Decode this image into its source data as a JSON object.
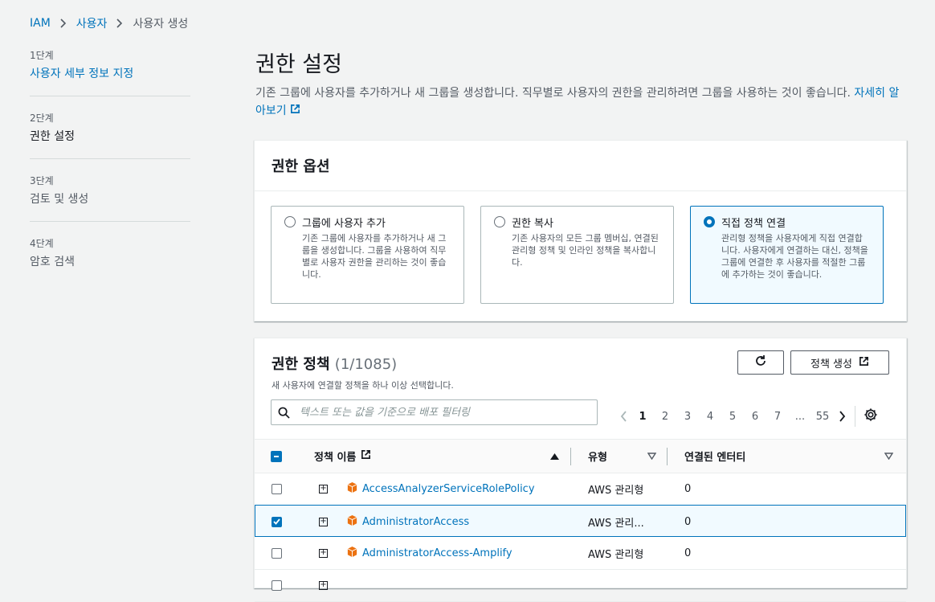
{
  "breadcrumb": [
    "IAM",
    "사용자",
    "사용자 생성"
  ],
  "steps": [
    {
      "num": "1단계",
      "label": "사용자 세부 정보 지정"
    },
    {
      "num": "2단계",
      "label": "권한 설정"
    },
    {
      "num": "3단계",
      "label": "검토 및 생성"
    },
    {
      "num": "4단계",
      "label": "암호 검색"
    }
  ],
  "page": {
    "title": "권한 설정",
    "description": "기존 그룹에 사용자를 추가하거나 새 그룹을 생성합니다. 직무별로 사용자의 권한을 관리하려면 그룹을 사용하는 것이 좋습니다. ",
    "learn_more": "자세히 알아보기"
  },
  "permission_options": {
    "title": "권한 옵션",
    "options": [
      {
        "title": "그룹에 사용자 추가",
        "desc": "기존 그룹에 사용자를 추가하거나 새 그룹을 생성합니다. 그룹을 사용하여 직무별로 사용자 권한을 관리하는 것이 좋습니다."
      },
      {
        "title": "권한 복사",
        "desc": "기존 사용자의 모든 그룹 멤버십, 연결된 관리형 정책 및 인라인 정책을 복사합니다."
      },
      {
        "title": "직접 정책 연결",
        "desc": "관리형 정책을 사용자에게 직접 연결합니다. 사용자에게 연결하는 대신, 정책을 그룹에 연결한 후 사용자를 적절한 그룹에 추가하는 것이 좋습니다."
      }
    ],
    "selected_index": 2
  },
  "policies": {
    "title": "권한 정책",
    "count": "(1/1085)",
    "subtitle": "새 사용자에 연결할 정책을 하나 이상 선택합니다.",
    "create_button": "정책 생성",
    "search_placeholder": "텍스트 또는 값을 기준으로 배포 필터링",
    "pages": [
      "1",
      "2",
      "3",
      "4",
      "5",
      "6",
      "7",
      "...",
      "55"
    ],
    "current_page": "1",
    "columns": {
      "name": "정책 이름",
      "type": "유형",
      "entities": "연결된 엔터티"
    },
    "rows": [
      {
        "name": "AccessAnalyzerServiceRolePolicy",
        "type": "AWS 관리형",
        "entities": "0",
        "checked": false
      },
      {
        "name": "AdministratorAccess",
        "type": "AWS 관리...",
        "entities": "0",
        "checked": true
      },
      {
        "name": "AdministratorAccess-Amplify",
        "type": "AWS 관리형",
        "entities": "0",
        "checked": false
      }
    ]
  },
  "colors": {
    "accent": "#0073bb",
    "aws_icon": "#ec7211"
  }
}
